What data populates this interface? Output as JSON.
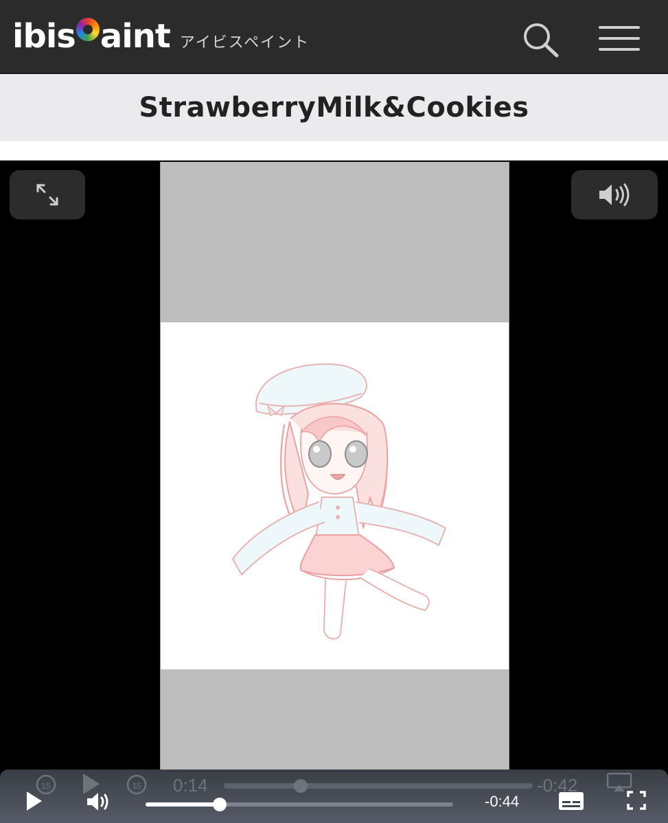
{
  "header": {
    "logo_text_left": "ibis",
    "logo_text_right": "aint",
    "logo_subtitle": "アイビスペイント",
    "search_icon": "search-icon",
    "menu_icon": "hamburger-menu-icon"
  },
  "page": {
    "title": "StrawberryMilk&Cookies"
  },
  "player": {
    "expand_icon": "expand-arrows-icon",
    "volume_icon": "speaker-volume-icon",
    "controls": {
      "current_time_ghost": "0:14",
      "remaining_time_ghost": "-0:42",
      "remaining_time": "-0:44",
      "skip_back_label": "15",
      "skip_forward_label": "15",
      "progress_fraction": 0.24
    }
  },
  "colors": {
    "header_bg": "#2b2b2b",
    "title_bar_bg": "#ebebee",
    "player_bg": "#000000",
    "video_letterbox": "#bdbdbd"
  }
}
